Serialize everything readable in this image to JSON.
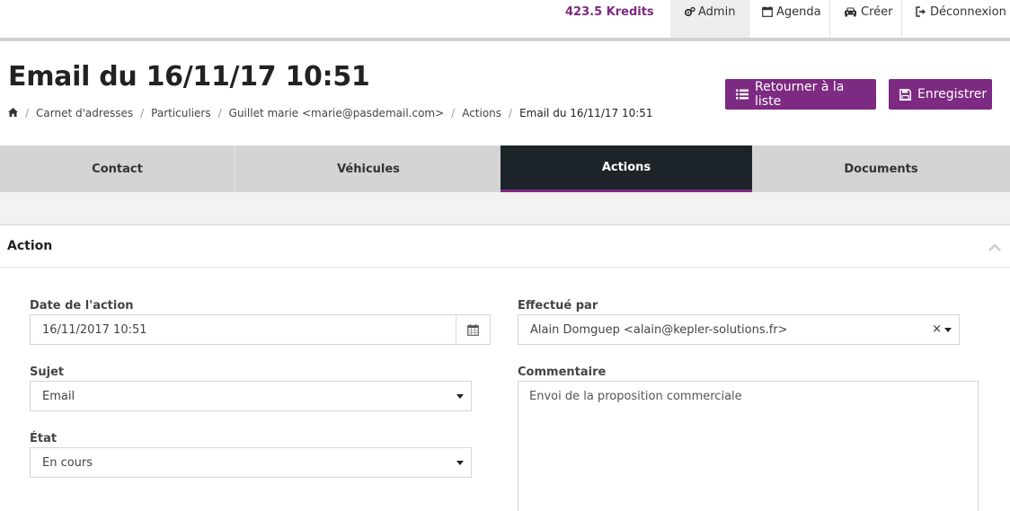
{
  "topbar": {
    "kredits": "423.5 Kredits",
    "nav": {
      "admin": "Admin",
      "agenda": "Agenda",
      "creer": "Créer",
      "deconnexion": "Déconnexion"
    }
  },
  "header": {
    "title": "Email du 16/11/17 10:51",
    "breadcrumb": {
      "carnet": "Carnet d'adresses",
      "particuliers": "Particuliers",
      "contact": "Guillet marie <marie@pasdemail.com>",
      "actions": "Actions",
      "current": "Email du 16/11/17 10:51"
    },
    "buttons": {
      "list": "Retourner à la liste",
      "save": "Enregistrer"
    }
  },
  "tabs": {
    "contact": "Contact",
    "vehicules": "Véhicules",
    "actions": "Actions",
    "documents": "Documents"
  },
  "panel": {
    "title": "Action",
    "date_label": "Date de l'action",
    "date_value": "16/11/2017 10:51",
    "sujet_label": "Sujet",
    "sujet_value": "Email",
    "etat_label": "État",
    "etat_value": "En cours",
    "effectue_label": "Effectué par",
    "effectue_value": "Alain Domguep <alain@kepler-solutions.fr>",
    "clear": "×",
    "commentaire_label": "Commentaire",
    "commentaire_value": "Envoi de la proposition commerciale"
  },
  "colors": {
    "accent": "#7d2a82",
    "active_tab": "#1c2429"
  }
}
